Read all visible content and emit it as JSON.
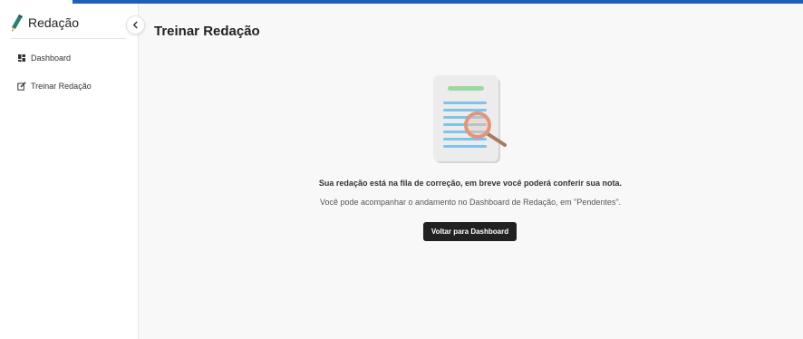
{
  "app": {
    "name": "Redação"
  },
  "sidebar": {
    "items": [
      {
        "label": "Dashboard",
        "icon": "dashboard-icon"
      },
      {
        "label": "Treinar Redação",
        "icon": "edit-icon"
      }
    ]
  },
  "page": {
    "title": "Treinar Redação",
    "message": "Sua redação está na fila de correção, em breve você poderá conferir sua nota.",
    "submessage": "Você pode acompanhar o andamento no Dashboard de Redação, em \"Pendentes\".",
    "button_label": "Voltar para Dashboard"
  },
  "colors": {
    "accent_bar": "#1f5fb4",
    "button_bg": "#212121",
    "text_line_blue": "#7ec3ea",
    "header_line_green": "#9bd9a0",
    "magnifier": "#e0967c"
  }
}
